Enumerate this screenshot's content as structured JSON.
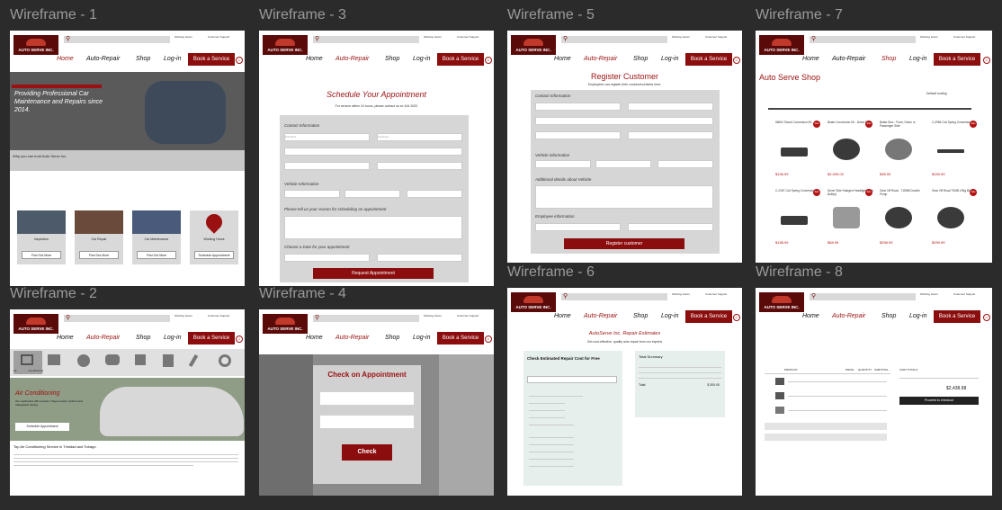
{
  "labels": [
    "Wireframe - 1",
    "Wireframe - 3",
    "Wireframe - 5",
    "Wireframe - 7",
    "Wireframe - 2",
    "Wireframe - 4",
    "Wireframe - 6",
    "Wireframe - 8"
  ],
  "common": {
    "brand": "AUTO SERVE INC.",
    "nav": [
      "Home",
      "Auto-Repair",
      "Shop",
      "Log-in"
    ],
    "book": "Book a Service",
    "working_hours": "Working Hours",
    "customer_support": "Customer Support",
    "accent": "#8b0d0d"
  },
  "wf1": {
    "hero": "Providing Professional Car Maintenance and Repairs since 2014.",
    "why": "Why you can trust Auto Serve Inc.",
    "services": [
      {
        "name": "Inspection",
        "btn": "Find Out More"
      },
      {
        "name": "Car Repair",
        "btn": "Find Out More"
      },
      {
        "name": "Car Maintenance",
        "btn": "Find Out More"
      },
      {
        "name": "Working Hours",
        "btn": "Schedule Appointment"
      }
    ]
  },
  "wf3": {
    "title": "Schedule Your Appointment",
    "sub": "For service within 24 hours, please contact us at: 444-3022",
    "contact": "Contact Information",
    "first": "First Name",
    "last": "Last Name",
    "vehicle": "Vehicle Information",
    "reason": "Please tell us your reason for scheduling an appointment",
    "date": "Choose a Date for your appointment",
    "submit": "Request Appointment"
  },
  "wf5": {
    "title": "Register Customer",
    "sub": "Employees can register their customers/clients here.",
    "contact": "Contact Information",
    "vehicle": "Vehicle information",
    "details": "Additional details about Vehicle",
    "employee": "Employee information",
    "submit": "Register customer"
  },
  "wf7": {
    "title": "Auto Serve Shop",
    "sorting": "Default sorting",
    "products": [
      {
        "name": "96600 Shock Conversion Kit",
        "price": "$196.99"
      },
      {
        "name": "Brake Conversion Kit - Direct Fit",
        "price": "$2,399.00"
      },
      {
        "name": "Brake Disc - Front, Driver or Passenger Side",
        "price": "$38.99"
      },
      {
        "name": "C-0956 Coil Spring Conversion Kit",
        "price": "$159.99"
      },
      {
        "name": "C-2187 Coil Spring Conversion Kit",
        "price": "$198.99"
      },
      {
        "name": "Driver Side Halogen Headlight, With Bulb(s)",
        "price": "$68.99"
      },
      {
        "name": "Gear Off Road - 715MB Double Pump",
        "price": "$298.99"
      },
      {
        "name": "Gear Off Road 70MB 2 Big Block",
        "price": "$299.99"
      }
    ]
  },
  "wf2": {
    "title": "Air Conditioning",
    "desc": "Our mechanics offer service 7 days a week. Upfront and transparent pricing.",
    "btn": "Schedule Appointment",
    "heading": "Top Air Conditioning Service in Trinidad and Tobago",
    "icons": [
      "Air Conditioning",
      "Batteries",
      "Brakes",
      "Car Checks",
      "DPF & Exhaust",
      "Oil Changes",
      "Suspension",
      "Tire Services"
    ]
  },
  "wf4": {
    "title": "Check on Appointment",
    "btn": "Check"
  },
  "wf6": {
    "title": "AutoServe Inc. Repair Estimates",
    "sub": "Get cost-effective, quality auto repair from our experts",
    "check": "Check Estimated Repair Cost for Free",
    "summary": "Total Summary",
    "total": "Total",
    "amount": "$ 300.00"
  },
  "wf8": {
    "product": "PRODUCT",
    "price": "PRICE",
    "quantity": "QUANTITY",
    "subtotal": "SUBTOTAL",
    "cart_totals": "CART TOTALS",
    "total": "$2,438.98",
    "checkout": "Proceed to checkout"
  }
}
